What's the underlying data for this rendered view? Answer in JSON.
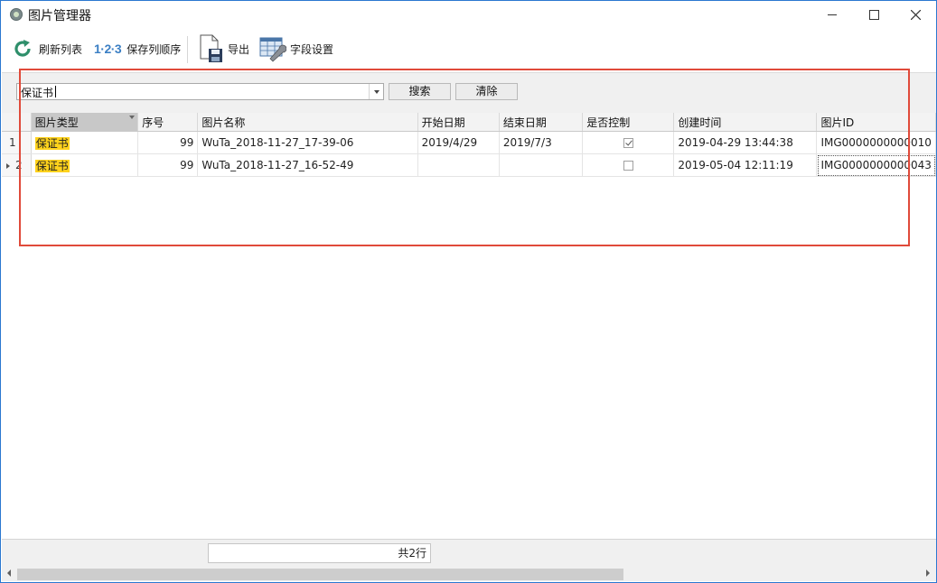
{
  "window": {
    "title": "图片管理器",
    "icon": "app-icon"
  },
  "toolbar": {
    "refresh_label": "刷新列表",
    "refresh_icon": "refresh-icon",
    "saveorder_icon_text": "1·2·3",
    "saveorder_label": "保存列顺序",
    "export_label": "导出",
    "export_icon": "save-disk-icon",
    "fields_label": "字段设置",
    "fields_icon": "wrench-settings-icon"
  },
  "search": {
    "value": "保证书",
    "search_button": "搜索",
    "clear_button": "清除"
  },
  "grid": {
    "columns": [
      "图片类型",
      "序号",
      "图片名称",
      "开始日期",
      "结束日期",
      "是否控制",
      "创建时间",
      "图片ID"
    ],
    "rows": [
      {
        "row_number": "1",
        "type": "保证书",
        "seq": "99",
        "name": "WuTa_2018-11-27_17-39-06",
        "start": "2019/4/29",
        "end": "2019/7/3",
        "controlled": true,
        "created": "2019-04-29 13:44:38",
        "id": "IMG0000000000010"
      },
      {
        "row_number": "2",
        "type": "保证书",
        "seq": "99",
        "name": "WuTa_2018-11-27_16-52-49",
        "start": "",
        "end": "",
        "controlled": false,
        "created": "2019-05-04 12:11:19",
        "id": "IMG0000000000043"
      }
    ]
  },
  "footer": {
    "count_text": "共2行"
  },
  "colors": {
    "highlight": "#ffd21c",
    "annotation_border": "#e04a3a",
    "accent": "#3b7fc4"
  }
}
